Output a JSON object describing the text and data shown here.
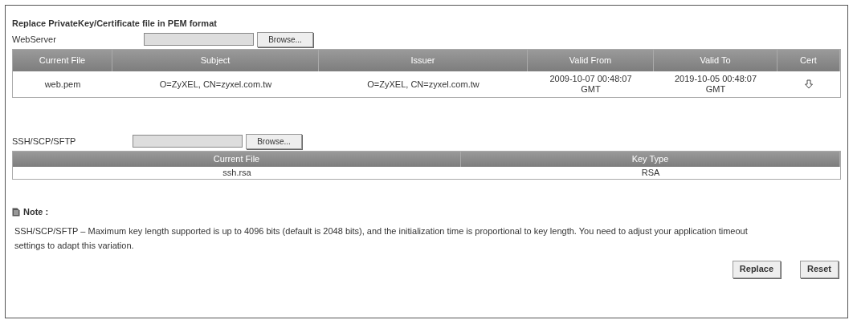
{
  "title": "Replace PrivateKey/Certificate file in PEM format",
  "webserver": {
    "label": "WebServer",
    "browse_button": "Browse..."
  },
  "cert_table": {
    "columns": [
      "Current File",
      "Subject",
      "Issuer",
      "Valid From",
      "Valid To",
      "Cert"
    ],
    "rows": [
      {
        "current_file": "web.pem",
        "subject": "O=ZyXEL, CN=zyxel.com.tw",
        "issuer": "O=ZyXEL, CN=zyxel.com.tw",
        "valid_from": "2009-10-07 00:48:07 GMT",
        "valid_to": "2019-10-05 00:48:07 GMT"
      }
    ]
  },
  "ssh": {
    "label": "SSH/SCP/SFTP",
    "browse_button": "Browse..."
  },
  "key_table": {
    "columns": [
      "Current File",
      "Key Type"
    ],
    "rows": [
      {
        "current_file": "ssh.rsa",
        "key_type": "RSA"
      }
    ]
  },
  "note": {
    "title": "Note :",
    "text": "SSH/SCP/SFTP – Maximum key length supported is up to 4096 bits (default is 2048 bits), and the initialization time is proportional to key length. You need to adjust your application timeout settings to adapt this variation."
  },
  "buttons": [
    "Replace",
    "Reset"
  ]
}
